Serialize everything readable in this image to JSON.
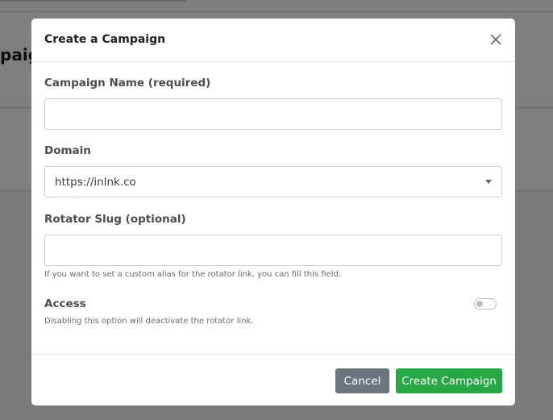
{
  "background": {
    "page_title": "paig"
  },
  "modal": {
    "title": "Create a Campaign",
    "campaign_name": {
      "label": "Campaign Name (required)",
      "value": ""
    },
    "domain": {
      "label": "Domain",
      "selected": "https://inlnk.co"
    },
    "rotator_slug": {
      "label": "Rotator Slug (optional)",
      "value": "",
      "help": "If you want to set a custom alias for the rotator link, you can fill this field."
    },
    "access": {
      "label": "Access",
      "help": "Disabling this option will deactivate the rotator link.",
      "enabled": false
    },
    "buttons": {
      "cancel": "Cancel",
      "create": "Create Campaign"
    }
  },
  "colors": {
    "cancel_bg": "#6c757d",
    "create_bg": "#28a745",
    "overlay": "rgba(0,0,0,0.5)"
  }
}
